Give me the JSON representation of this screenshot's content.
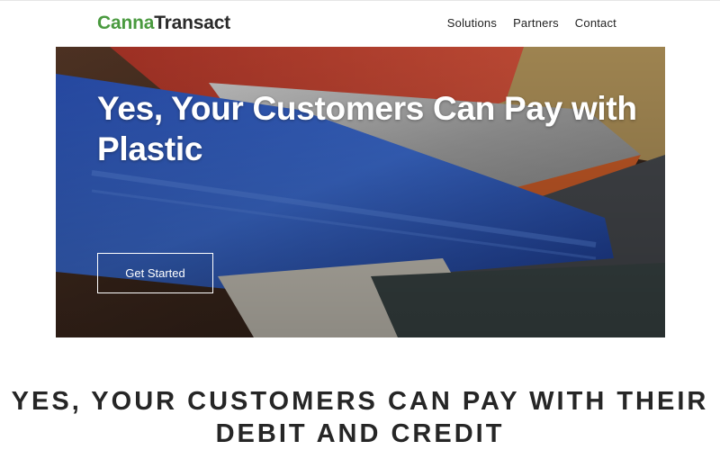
{
  "header": {
    "logo_part1": "Canna",
    "logo_part2": "Transact",
    "nav": [
      "Solutions",
      "Partners",
      "Contact"
    ]
  },
  "hero": {
    "title": "Yes, Your Customers Can Pay with Plastic",
    "cta_label": "Get Started",
    "background": "credit-cards-photo"
  },
  "section": {
    "heading": "YES, YOUR CUSTOMERS CAN PAY WITH THEIR DEBIT AND CREDIT"
  },
  "colors": {
    "brand_green": "#4a9a3f",
    "text_dark": "#262626"
  }
}
